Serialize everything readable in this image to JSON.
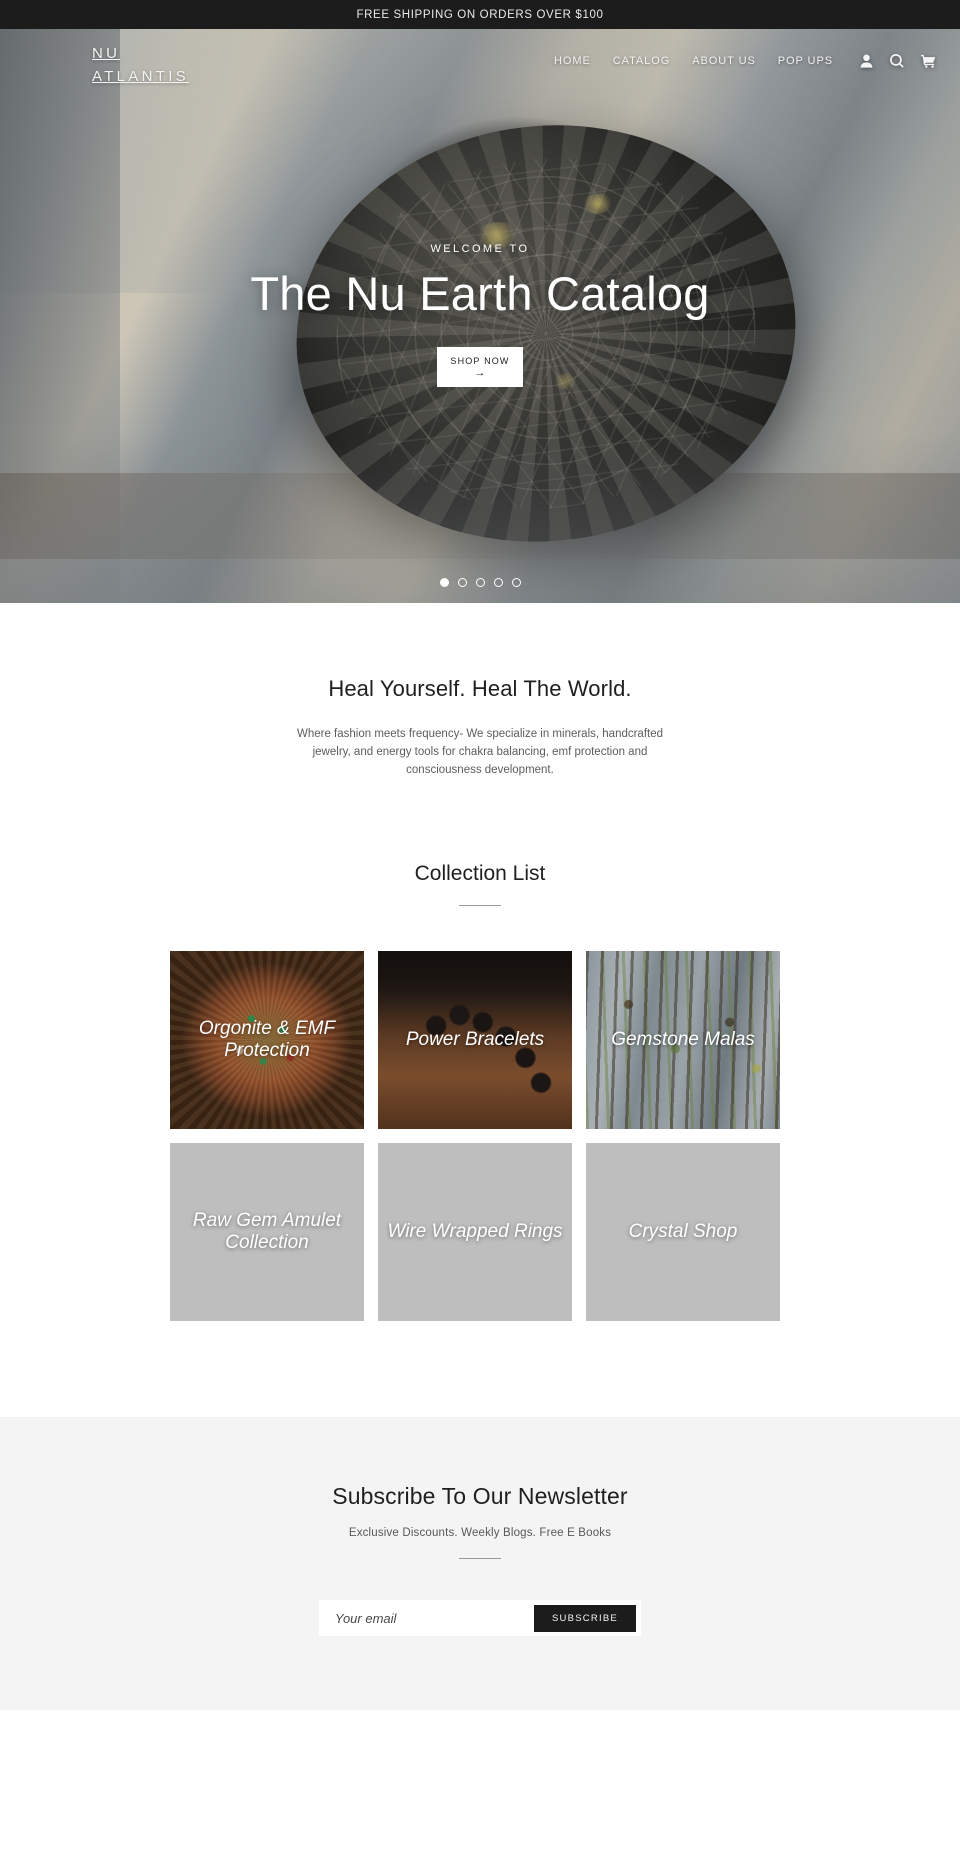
{
  "announcement": {
    "text": "FREE SHIPPING ON ORDERS OVER $100"
  },
  "header": {
    "brand": "NU\nATLANTIS",
    "nav": [
      {
        "label": "HOME"
      },
      {
        "label": "CATALOG"
      },
      {
        "label": "ABOUT US"
      },
      {
        "label": "POP UPS"
      }
    ],
    "icons": [
      {
        "name": "account-icon"
      },
      {
        "name": "search-icon"
      },
      {
        "name": "cart-icon"
      }
    ]
  },
  "hero": {
    "kicker": "WELCOME TO",
    "title": "The Nu Earth Catalog",
    "button_label": "SHOP NOW",
    "button_arrow": "→",
    "slides": 5,
    "active_slide": 1
  },
  "intro": {
    "heading": "Heal Yourself. Heal The World.",
    "body": "Where fashion meets frequency- We specialize in minerals, handcrafted jewelry, and energy tools for chakra balancing, emf protection and consciousness development."
  },
  "collections": {
    "heading": "Collection List",
    "items": [
      {
        "title": "Orgonite & EMF Protection",
        "art": "art-orgonite"
      },
      {
        "title": "Power Bracelets",
        "art": "art-bracelets"
      },
      {
        "title": "Gemstone Malas",
        "art": "art-malas"
      },
      {
        "title": "Raw Gem Amulet Collection",
        "art": "art-placeholder"
      },
      {
        "title": "Wire Wrapped Rings",
        "art": "art-placeholder"
      },
      {
        "title": "Crystal Shop",
        "art": "art-placeholder"
      }
    ]
  },
  "newsletter": {
    "heading": "Subscribe To Our Newsletter",
    "subheading": "Exclusive Discounts. Weekly Blogs. Free E Books",
    "email_placeholder": "Your email",
    "email_value": "",
    "submit_label": "SUBSCRIBE"
  },
  "colors": {
    "dark": "#1c1c1c",
    "page_bg": "#ffffff",
    "footer_bg": "#f4f4f4",
    "placeholder": "#bebebe",
    "text": "#3a3a3a"
  }
}
